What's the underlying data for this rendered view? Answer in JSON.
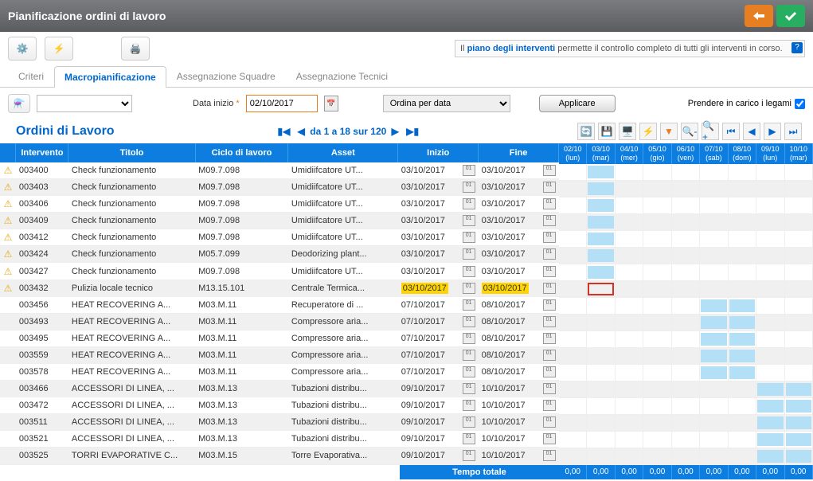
{
  "title": "Pianificazione ordini di lavoro",
  "info": {
    "prefix": "Il ",
    "link": "piano degli interventi",
    "suffix": " permette il controllo completo di tutti gli interventi in corso."
  },
  "tabs": [
    "Criteri",
    "Macropianificazione",
    "Assegnazione Squadre",
    "Assegnazione Tecnici"
  ],
  "active_tab": 1,
  "filters": {
    "data_inizio_label": "Data inizio",
    "data_inizio_value": "02/10/2017",
    "sort_value": "Ordina per data",
    "apply_label": "Applicare",
    "legami_label": "Prendere in carico i legami"
  },
  "section_title": "Ordini di Lavoro",
  "pager": {
    "text": "da 1 a 18 sur 120"
  },
  "columns": [
    "",
    "Intervento",
    "Titolo",
    "Ciclo di lavoro",
    "Asset",
    "Inizio",
    "Fine"
  ],
  "gantt_days": [
    {
      "d": "02/10",
      "w": "(lun)"
    },
    {
      "d": "03/10",
      "w": "(mar)"
    },
    {
      "d": "04/10",
      "w": "(mer)"
    },
    {
      "d": "05/10",
      "w": "(gio)"
    },
    {
      "d": "06/10",
      "w": "(ven)"
    },
    {
      "d": "07/10",
      "w": "(sab)"
    },
    {
      "d": "08/10",
      "w": "(dom)"
    },
    {
      "d": "09/10",
      "w": "(lun)"
    },
    {
      "d": "10/10",
      "w": "(mar)"
    }
  ],
  "rows": [
    {
      "warn": true,
      "int": "003400",
      "titolo": "Check funzionamento",
      "ciclo": "M09.7.098",
      "asset": "Umidiifcatore UT...",
      "inizio": "03/10/2017",
      "fine": "03/10/2017",
      "bar": [
        1
      ],
      "hl": false
    },
    {
      "warn": true,
      "int": "003403",
      "titolo": "Check funzionamento",
      "ciclo": "M09.7.098",
      "asset": "Umidiifcatore UT...",
      "inizio": "03/10/2017",
      "fine": "03/10/2017",
      "bar": [
        1
      ],
      "hl": false
    },
    {
      "warn": true,
      "int": "003406",
      "titolo": "Check funzionamento",
      "ciclo": "M09.7.098",
      "asset": "Umidiifcatore UT...",
      "inizio": "03/10/2017",
      "fine": "03/10/2017",
      "bar": [
        1
      ],
      "hl": false
    },
    {
      "warn": true,
      "int": "003409",
      "titolo": "Check funzionamento",
      "ciclo": "M09.7.098",
      "asset": "Umidiifcatore UT...",
      "inizio": "03/10/2017",
      "fine": "03/10/2017",
      "bar": [
        1
      ],
      "hl": false
    },
    {
      "warn": true,
      "int": "003412",
      "titolo": "Check funzionamento",
      "ciclo": "M09.7.098",
      "asset": "Umidiifcatore UT...",
      "inizio": "03/10/2017",
      "fine": "03/10/2017",
      "bar": [
        1
      ],
      "hl": false
    },
    {
      "warn": true,
      "int": "003424",
      "titolo": "Check funzionamento",
      "ciclo": "M05.7.099",
      "asset": "Deodorizing plant...",
      "inizio": "03/10/2017",
      "fine": "03/10/2017",
      "bar": [
        1
      ],
      "hl": false
    },
    {
      "warn": true,
      "int": "003427",
      "titolo": "Check funzionamento",
      "ciclo": "M09.7.098",
      "asset": "Umidiifcatore UT...",
      "inizio": "03/10/2017",
      "fine": "03/10/2017",
      "bar": [
        1
      ],
      "hl": false
    },
    {
      "warn": true,
      "int": "003432",
      "titolo": "Pulizia locale tecnico",
      "ciclo": "M13.15.101",
      "asset": "Centrale Termica...",
      "inizio": "03/10/2017",
      "fine": "03/10/2017",
      "bar": [
        1
      ],
      "hl": true,
      "red": true
    },
    {
      "warn": false,
      "int": "003456",
      "titolo": "HEAT RECOVERING A...",
      "ciclo": "M03.M.11",
      "asset": "Recuperatore di ...",
      "inizio": "07/10/2017",
      "fine": "08/10/2017",
      "bar": [
        5,
        6
      ],
      "hl": false
    },
    {
      "warn": false,
      "int": "003493",
      "titolo": "HEAT RECOVERING A...",
      "ciclo": "M03.M.11",
      "asset": "Compressore aria...",
      "inizio": "07/10/2017",
      "fine": "08/10/2017",
      "bar": [
        5,
        6
      ],
      "hl": false
    },
    {
      "warn": false,
      "int": "003495",
      "titolo": "HEAT RECOVERING A...",
      "ciclo": "M03.M.11",
      "asset": "Compressore aria...",
      "inizio": "07/10/2017",
      "fine": "08/10/2017",
      "bar": [
        5,
        6
      ],
      "hl": false
    },
    {
      "warn": false,
      "int": "003559",
      "titolo": "HEAT RECOVERING A...",
      "ciclo": "M03.M.11",
      "asset": "Compressore aria...",
      "inizio": "07/10/2017",
      "fine": "08/10/2017",
      "bar": [
        5,
        6
      ],
      "hl": false
    },
    {
      "warn": false,
      "int": "003578",
      "titolo": "HEAT RECOVERING A...",
      "ciclo": "M03.M.11",
      "asset": "Compressore aria...",
      "inizio": "07/10/2017",
      "fine": "08/10/2017",
      "bar": [
        5,
        6
      ],
      "hl": false
    },
    {
      "warn": false,
      "int": "003466",
      "titolo": "ACCESSORI DI LINEA, ...",
      "ciclo": "M03.M.13",
      "asset": "Tubazioni distribu...",
      "inizio": "09/10/2017",
      "fine": "10/10/2017",
      "bar": [
        7,
        8
      ],
      "hl": false
    },
    {
      "warn": false,
      "int": "003472",
      "titolo": "ACCESSORI DI LINEA, ...",
      "ciclo": "M03.M.13",
      "asset": "Tubazioni distribu...",
      "inizio": "09/10/2017",
      "fine": "10/10/2017",
      "bar": [
        7,
        8
      ],
      "hl": false
    },
    {
      "warn": false,
      "int": "003511",
      "titolo": "ACCESSORI DI LINEA, ...",
      "ciclo": "M03.M.13",
      "asset": "Tubazioni distribu...",
      "inizio": "09/10/2017",
      "fine": "10/10/2017",
      "bar": [
        7,
        8
      ],
      "hl": false
    },
    {
      "warn": false,
      "int": "003521",
      "titolo": "ACCESSORI DI LINEA, ...",
      "ciclo": "M03.M.13",
      "asset": "Tubazioni distribu...",
      "inizio": "09/10/2017",
      "fine": "10/10/2017",
      "bar": [
        7,
        8
      ],
      "hl": false
    },
    {
      "warn": false,
      "int": "003525",
      "titolo": "TORRI EVAPORATIVE C...",
      "ciclo": "M03.M.15",
      "asset": "Torre Evaporativa...",
      "inizio": "09/10/2017",
      "fine": "10/10/2017",
      "bar": [
        7,
        8
      ],
      "hl": false
    }
  ],
  "footer": {
    "label": "Tempo totale",
    "values": [
      "0,00",
      "0,00",
      "0,00",
      "0,00",
      "0,00",
      "0,00",
      "0,00",
      "0,00",
      "0,00"
    ]
  }
}
